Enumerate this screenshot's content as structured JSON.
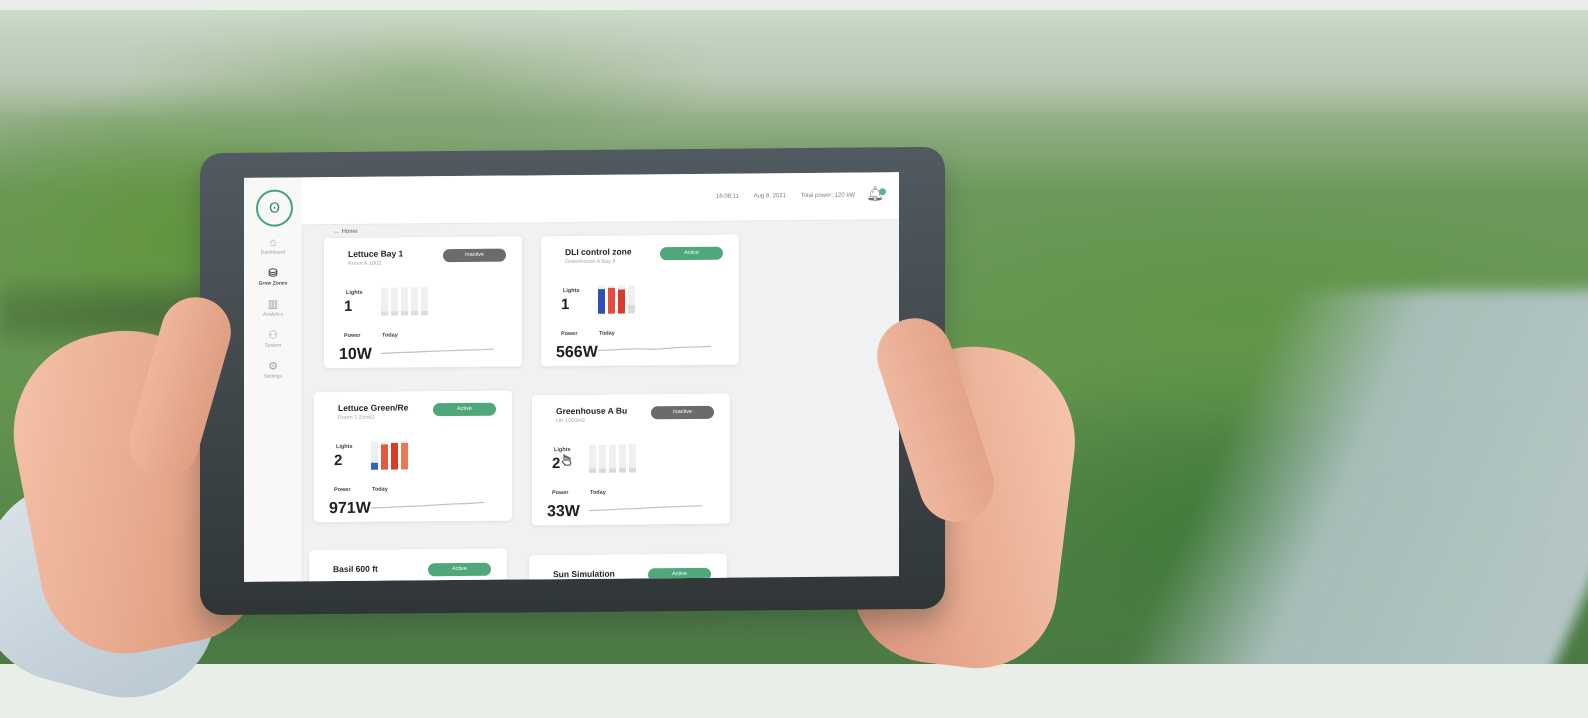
{
  "scene": {
    "photo": "blurred greenhouse seedling beds",
    "device": "tablet held in two hands"
  },
  "app": {
    "logo": "Ꙩ",
    "topbar": {
      "time": "16:08:11",
      "date": "Aug 8, 2021",
      "total_power": "Total power: 120 kW"
    },
    "icons": {
      "notification": "bell-icon"
    },
    "nav": [
      {
        "label": "Dashboard",
        "icon": "home-icon",
        "glyph": "⌂",
        "active": false
      },
      {
        "label": "Grow Zones",
        "icon": "plant-icon",
        "glyph": "⛁",
        "active": true
      },
      {
        "label": "Analytics",
        "icon": "chart-icon",
        "glyph": "▥",
        "active": false
      },
      {
        "label": "System",
        "icon": "user-icon",
        "glyph": "⚇",
        "active": false
      },
      {
        "label": "Settings",
        "icon": "gear-icon",
        "glyph": "⚙",
        "active": false
      }
    ],
    "back_link": "← Home"
  },
  "cards": [
    {
      "title": "Lettuce Bay 1",
      "subtitle": "Room A 1002",
      "status": "Inactive",
      "state": "inactive",
      "lights_label": "Lights",
      "lights": "1",
      "power_label": "Power",
      "today_label": "Today",
      "power": "10W",
      "bar_levels": [
        0.15,
        0.15,
        0.15,
        0.15,
        0.15
      ],
      "bar_colors": [
        "#dcdcdc",
        "#dcdcdc",
        "#dcdcdc",
        "#dcdcdc",
        "#dcdcdc"
      ],
      "trend": [
        0.3,
        0.35,
        0.38,
        0.42,
        0.45,
        0.48,
        0.5,
        0.54
      ]
    },
    {
      "title": "DLI control zone",
      "subtitle": "Greenhouse A Bay 4",
      "status": "Active",
      "state": "active",
      "lights_label": "Lights",
      "lights": "1",
      "power_label": "Power",
      "today_label": "Today",
      "power": "566W",
      "bar_levels": [
        0.88,
        0.92,
        0.86,
        0.3
      ],
      "bar_colors": [
        "#2d4fb7",
        "#e74c3c",
        "#d63b2c",
        "#dcdcdc"
      ],
      "trend": [
        0.38,
        0.41,
        0.46,
        0.47,
        0.42,
        0.5,
        0.55,
        0.57,
        0.6
      ]
    },
    {
      "title": "Lettuce Green/Re",
      "subtitle": "Room 1 Zone2",
      "status": "Active",
      "state": "active",
      "lights_label": "Lights",
      "lights": "2",
      "power_label": "Power",
      "today_label": "Today",
      "power": "971W",
      "bar_levels": [
        0.25,
        0.9,
        0.95,
        0.95
      ],
      "bar_colors": [
        "#3361c7",
        "#e45a3f",
        "#d83c2a",
        "#e67a55"
      ],
      "trend": [
        0.28,
        0.3,
        0.36,
        0.38,
        0.44,
        0.5,
        0.53,
        0.6
      ]
    },
    {
      "title": "Greenhouse A Bu",
      "subtitle": "UK 1000m2",
      "status": "Inactive",
      "state": "inactive",
      "lights_label": "Lights",
      "lights": "2",
      "power_label": "Power",
      "today_label": "Today",
      "power": "33W",
      "bar_levels": [
        0.15,
        0.15,
        0.15,
        0.15,
        0.15
      ],
      "bar_colors": [
        "#d8d8d8",
        "#d8d8d8",
        "#d8d8d8",
        "#d8d8d8",
        "#d8d8d8"
      ],
      "trend": [
        0.3,
        0.34,
        0.39,
        0.42,
        0.48,
        0.52,
        0.55,
        0.58
      ]
    },
    {
      "title": "Basil 600 ft",
      "subtitle": "",
      "status": "Active",
      "state": "active"
    },
    {
      "title": "Sun Simulation",
      "subtitle": "",
      "status": "Active",
      "state": "active"
    }
  ]
}
